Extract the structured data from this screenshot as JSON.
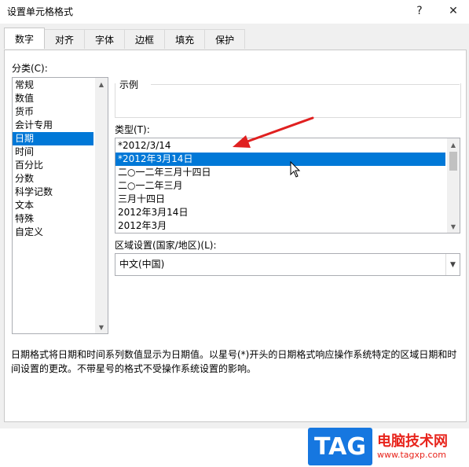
{
  "window": {
    "title": "设置单元格格式",
    "help_label": "?",
    "close_label": "✕"
  },
  "tabs": [
    {
      "label": "数字"
    },
    {
      "label": "对齐"
    },
    {
      "label": "字体"
    },
    {
      "label": "边框"
    },
    {
      "label": "填充"
    },
    {
      "label": "保护"
    }
  ],
  "category": {
    "label": "分类(C):",
    "items": [
      "常规",
      "数值",
      "货币",
      "会计专用",
      "日期",
      "时间",
      "百分比",
      "分数",
      "科学记数",
      "文本",
      "特殊",
      "自定义"
    ],
    "selected": "日期"
  },
  "sample": {
    "label": "示例",
    "value": ""
  },
  "type": {
    "label": "类型(T):",
    "items": [
      "*2012/3/14",
      "*2012年3月14日",
      "二○一二年三月十四日",
      "二○一二年三月",
      "三月十四日",
      "2012年3月14日",
      "2012年3月"
    ],
    "selected": "*2012年3月14日"
  },
  "locale": {
    "label": "区域设置(国家/地区)(L):",
    "value": "中文(中国)"
  },
  "description": "日期格式将日期和时间系列数值显示为日期值。以星号(*)开头的日期格式响应操作系统特定的区域日期和时间设置的更改。不带星号的格式不受操作系统设置的影响。",
  "watermark": {
    "logo": "TAG",
    "title": "电脑技术网",
    "url": "www.tagxp.com"
  },
  "colors": {
    "selection": "#0078d7",
    "annotation_arrow": "#e02020"
  }
}
